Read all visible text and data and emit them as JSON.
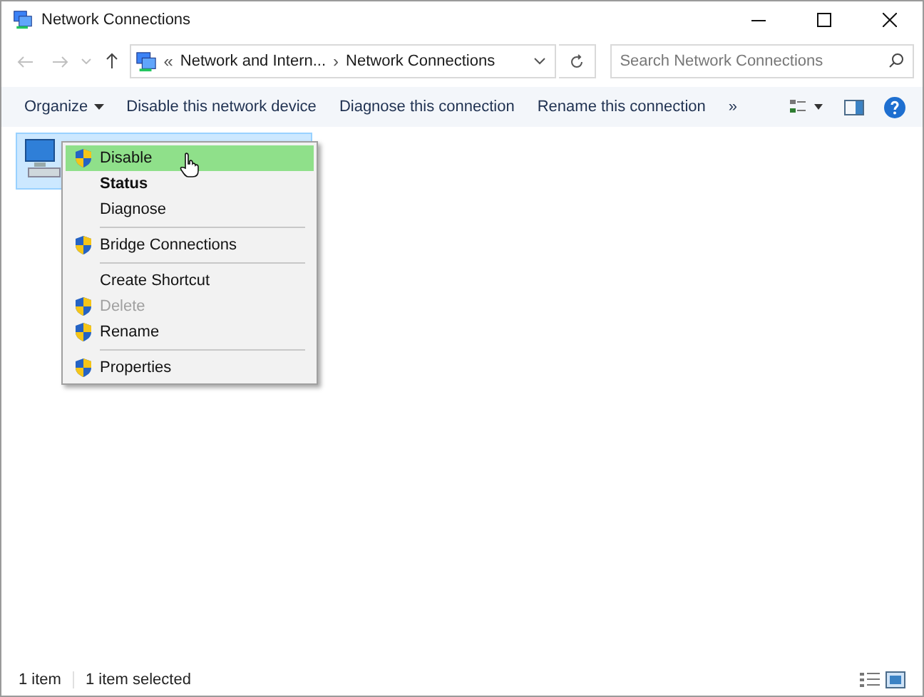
{
  "window": {
    "title": "Network Connections"
  },
  "address": {
    "prefix": "«",
    "crumbs": [
      "Network and Intern...",
      "Network Connections"
    ],
    "separator": "›"
  },
  "search": {
    "placeholder": "Search Network Connections"
  },
  "toolbar": {
    "items": [
      {
        "label": "Organize",
        "dropdown": true
      },
      {
        "label": "Disable this network device",
        "dropdown": false
      },
      {
        "label": "Diagnose this connection",
        "dropdown": false
      },
      {
        "label": "Rename this connection",
        "dropdown": false
      }
    ],
    "overflow": "»"
  },
  "files": [
    {
      "selected": true
    }
  ],
  "context_menu": [
    {
      "kind": "item",
      "label": "Disable",
      "shield": true,
      "bold": false,
      "disabled": false,
      "selected": true
    },
    {
      "kind": "item",
      "label": "Status",
      "shield": false,
      "bold": true,
      "disabled": false,
      "selected": false
    },
    {
      "kind": "item",
      "label": "Diagnose",
      "shield": false,
      "bold": false,
      "disabled": false,
      "selected": false
    },
    {
      "kind": "separator"
    },
    {
      "kind": "item",
      "label": "Bridge Connections",
      "shield": true,
      "bold": false,
      "disabled": false,
      "selected": false
    },
    {
      "kind": "separator"
    },
    {
      "kind": "item",
      "label": "Create Shortcut",
      "shield": false,
      "bold": false,
      "disabled": false,
      "selected": false
    },
    {
      "kind": "item",
      "label": "Delete",
      "shield": true,
      "bold": false,
      "disabled": true,
      "selected": false
    },
    {
      "kind": "item",
      "label": "Rename",
      "shield": true,
      "bold": false,
      "disabled": false,
      "selected": false
    },
    {
      "kind": "separator"
    },
    {
      "kind": "item",
      "label": "Properties",
      "shield": true,
      "bold": false,
      "disabled": false,
      "selected": false
    }
  ],
  "status_bar": {
    "count": "1 item",
    "selection": "1 item selected"
  }
}
